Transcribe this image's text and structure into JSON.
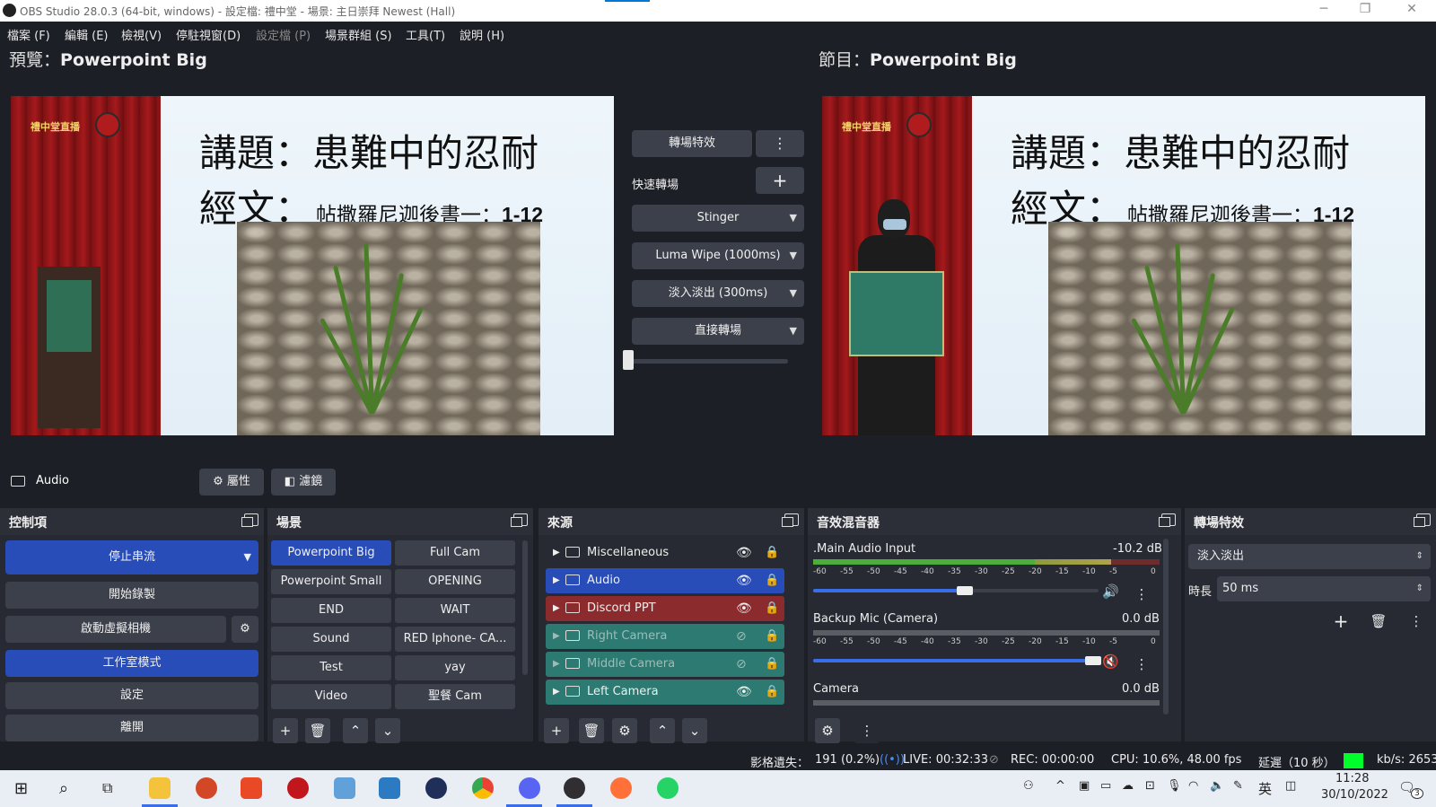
{
  "window": {
    "title": "OBS Studio 28.0.3 (64-bit, windows) - 設定檔: 禮中堂 - 場景: 主日崇拜 Newest (Hall)"
  },
  "menu": [
    "檔案 (F)",
    "編輯 (E)",
    "檢視(V)",
    "停駐視窗(D)",
    "設定檔 (P)",
    "場景群組 (S)",
    "工具(T)",
    "說明 (H)"
  ],
  "preview": {
    "label": "預覽：",
    "scene": "Powerpoint Big"
  },
  "program": {
    "label": "節目：",
    "scene": "Powerpoint Big"
  },
  "slide": {
    "brand": "禮中堂直播",
    "topic": "講題：患難中的忍耐",
    "verse_label": "經文：",
    "verse_book": "帖撒羅尼迦後書一：",
    "verse_ref": "1-12"
  },
  "transitions_center": {
    "transition_button": "轉場特效",
    "quick_label": "快速轉場",
    "quick": [
      "Stinger",
      "Luma Wipe (1000ms)",
      "淡入淡出 (300ms)",
      "直接轉場"
    ],
    "tbar_value": 0
  },
  "context_bar": {
    "source": "Audio",
    "properties": "屬性",
    "filters": "濾鏡"
  },
  "controls": {
    "title": "控制項",
    "stop_stream": "停止串流",
    "start_record": "開始錄製",
    "virtual_cam": "啟動虛擬相機",
    "studio_mode": "工作室模式",
    "settings": "設定",
    "exit": "離開"
  },
  "scenes": {
    "title": "場景",
    "items": [
      "Powerpoint Big",
      "Full Cam",
      "Powerpoint Small",
      "OPENING",
      "END",
      "WAIT",
      "Sound",
      "RED Iphone- CA...",
      "Test",
      "yay",
      "Video",
      "聖餐 Cam"
    ],
    "selected": "Powerpoint Big"
  },
  "sources": {
    "title": "來源",
    "items": [
      {
        "name": "Miscellaneous",
        "visible": true
      },
      {
        "name": "Audio",
        "visible": true
      },
      {
        "name": "Discord PPT",
        "visible": true
      },
      {
        "name": "Right Camera",
        "visible": false
      },
      {
        "name": "Middle Camera",
        "visible": false
      },
      {
        "name": "Left Camera",
        "visible": true
      }
    ]
  },
  "mixer": {
    "title": "音效混音器",
    "scale": [
      "-60",
      "-55",
      "-50",
      "-45",
      "-40",
      "-35",
      "-30",
      "-25",
      "-20",
      "-15",
      "-10",
      "-5",
      "0"
    ],
    "channels": [
      {
        "name": ".Main Audio Input",
        "db": "-10.2 dB",
        "volume": 0.53,
        "muted": false
      },
      {
        "name": "Backup Mic (Camera)",
        "db": "0.0 dB",
        "volume": 0.98,
        "muted": true
      },
      {
        "name": "Camera",
        "db": "0.0 dB"
      }
    ]
  },
  "transition_dock": {
    "title": "轉場特效",
    "selected": "淡入淡出",
    "duration_label": "時長",
    "duration": "50 ms"
  },
  "status": {
    "dropped": "影格遺失：",
    "dropped_val": "191 (0.2%)",
    "live": "LIVE: 00:32:33",
    "rec": "REC: 00:00:00",
    "cpu": "CPU: 10.6%, 48.00 fps",
    "delay": "延遲（10 秒）",
    "kbs": "kb/s: 2653"
  },
  "taskbar": {
    "time": "11:28",
    "date": "30/10/2022",
    "lang": "英",
    "notif": "3"
  },
  "colors": {
    "accent": "#284cb8",
    "bg": "#1d1f26",
    "panel": "#272a33",
    "button": "#3c404b",
    "discord": "#8c2b2e",
    "camera": "#2d7a72"
  }
}
